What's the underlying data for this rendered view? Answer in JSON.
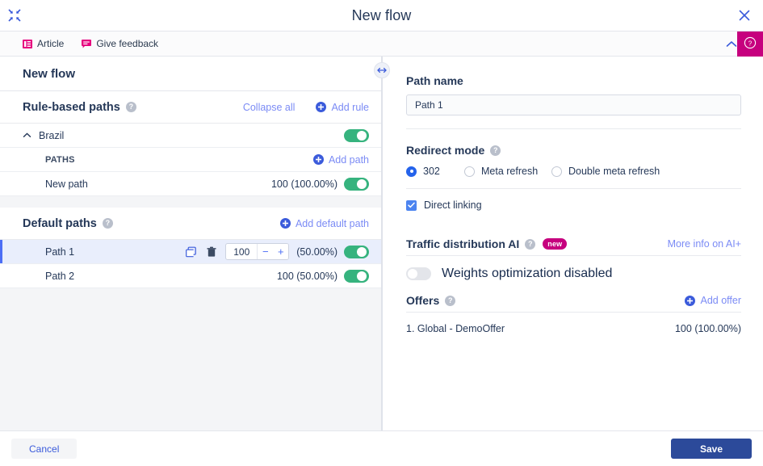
{
  "window": {
    "title": "New flow",
    "minimize_icon": "collapse-arrows-icon",
    "close_icon": "close-icon"
  },
  "feedbar": {
    "items": [
      {
        "label": "Article",
        "icon": "article-icon"
      },
      {
        "label": "Give feedback",
        "icon": "comment-icon"
      }
    ],
    "collapse_icon": "chevron-up-icon",
    "help_icon": "help-circle-icon",
    "help_color": "#c6007e"
  },
  "left": {
    "flow_title": "New flow",
    "rule_section": {
      "title": "Rule-based paths",
      "help_icon": "question-icon",
      "collapse_all": "Collapse all",
      "add_rule": "Add rule",
      "rule": {
        "name": "Brazil",
        "chevron": "chevron-up-icon",
        "enabled": true
      },
      "paths_label": "PATHS",
      "add_path": "Add path",
      "paths": [
        {
          "name": "New path",
          "weight": "100 (100.00%)",
          "enabled": true
        }
      ]
    },
    "default_section": {
      "title": "Default paths",
      "help_icon": "question-icon",
      "add_default_path": "Add default path",
      "paths": [
        {
          "name": "Path 1",
          "selected": true,
          "stepper_value": "100",
          "minus": "−",
          "plus": "+",
          "percent": "(50.00%)",
          "enabled": true,
          "copy_icon": "copy-icon",
          "delete_icon": "trash-icon"
        },
        {
          "name": "Path 2",
          "selected": false,
          "weight": "100 (50.00%)",
          "enabled": true
        }
      ]
    }
  },
  "right": {
    "path_name": {
      "label": "Path name",
      "value": "Path 1",
      "placeholder": "Path name"
    },
    "redirect_mode": {
      "label": "Redirect mode",
      "help_icon": "question-icon",
      "options": [
        {
          "label": "302",
          "checked": true
        },
        {
          "label": "Meta refresh",
          "checked": false
        },
        {
          "label": "Double meta refresh",
          "checked": false
        }
      ]
    },
    "direct_linking": {
      "label": "Direct linking",
      "checked": true
    },
    "traffic_ai": {
      "title": "Traffic distribution AI",
      "help_icon": "question-icon",
      "badge": "new",
      "more_info": "More info on AI+",
      "toggle_label": "Weights optimization disabled",
      "toggle_on": false
    },
    "offers": {
      "title": "Offers",
      "help_icon": "question-icon",
      "add_offer": "Add offer",
      "rows": [
        {
          "name": "1. Global - DemoOffer",
          "weight": "100 (100.00%)"
        }
      ]
    }
  },
  "footer": {
    "cancel": "Cancel",
    "save": "Save"
  },
  "colors": {
    "accent_blue": "#4c6ef5",
    "toggle_on": "#36b37e",
    "magenta": "#c6007e",
    "save_blue": "#2c4a9a"
  }
}
